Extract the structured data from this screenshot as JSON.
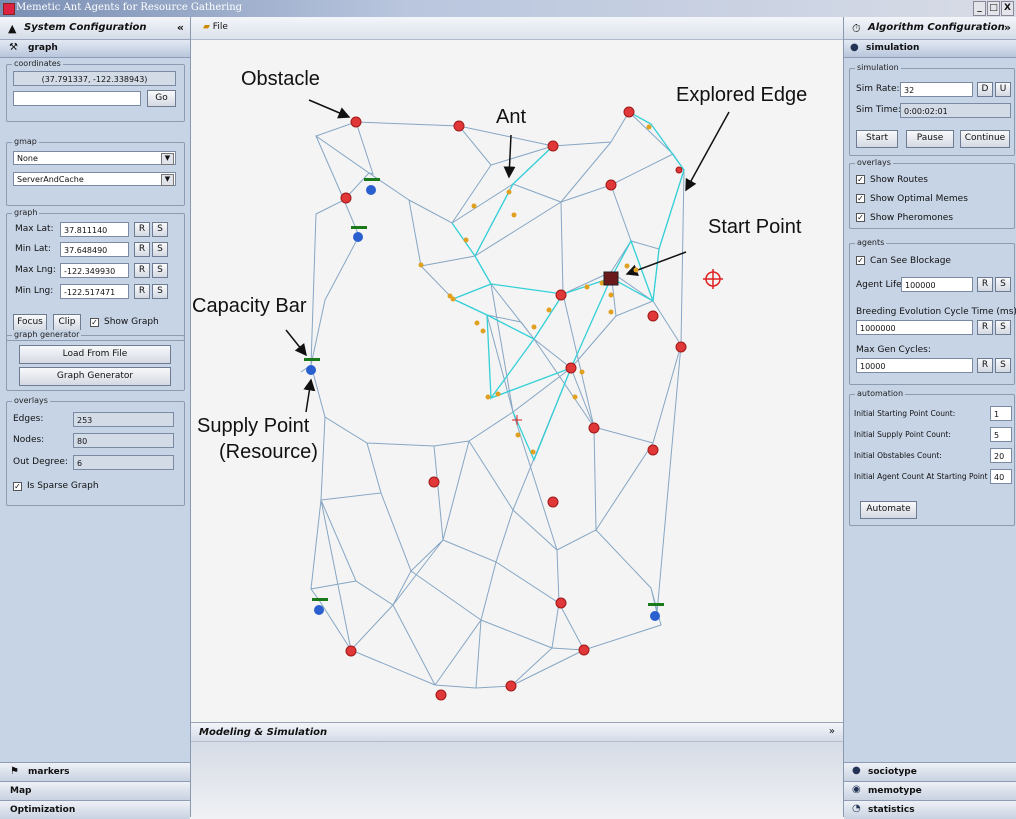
{
  "window": {
    "title": "Memetic Ant Agents for Resource Gathering",
    "controls": [
      "_",
      "□",
      "X"
    ]
  },
  "left_panel": {
    "title": "System Configuration",
    "collapse": "«",
    "tab": "graph",
    "coordinates": {
      "label": "coordinates",
      "value": "(37.791337, -122.338943)",
      "input": "",
      "go": "Go"
    },
    "gmap": {
      "label": "gmap",
      "select1": "None",
      "select2": "ServerAndCache"
    },
    "graph": {
      "label": "graph",
      "rows": [
        {
          "label": "Max Lat:",
          "value": "37.811140"
        },
        {
          "label": "Min Lat:",
          "value": "37.648490"
        },
        {
          "label": "Max Lng:",
          "value": "-122.349930"
        },
        {
          "label": "Min Lng:",
          "value": "-122.517471"
        }
      ],
      "r": "R",
      "s": "S",
      "focus": "Focus",
      "clip": "Clip",
      "show_graph": "Show Graph"
    },
    "generator": {
      "label": "graph generator",
      "load": "Load From File",
      "gen": "Graph Generator"
    },
    "overlays": {
      "label": "overlays",
      "edges_label": "Edges:",
      "edges": "253",
      "nodes_label": "Nodes:",
      "nodes": "80",
      "out_label": "Out Degree:",
      "out": "6",
      "sparse": "Is Sparse Graph"
    },
    "bottom_tabs": [
      "markers",
      "Map",
      "Optimization"
    ]
  },
  "center": {
    "menu": "File",
    "modeling": "Modeling & Simulation",
    "modeling_chev": "»"
  },
  "annotations": {
    "obstacle": "Obstacle",
    "ant": "Ant",
    "explored": "Explored Edge",
    "start": "Start Point",
    "capacity": "Capacity Bar",
    "supply1": "Supply Point",
    "supply2": "(Resource)"
  },
  "right_panel": {
    "title": "Algorithm Configuration",
    "collapse": "»",
    "tab": "simulation",
    "simulation": {
      "label": "simulation",
      "rate_label": "Sim Rate:",
      "rate": "32",
      "d": "D",
      "u": "U",
      "time_label": "Sim Time:",
      "time": "0:00:02:01",
      "start": "Start",
      "pause": "Pause",
      "cont": "Continue"
    },
    "overlays": {
      "label": "overlays",
      "routes": "Show Routes",
      "memes": "Show Optimal Memes",
      "pher": "Show Pheromones"
    },
    "agents": {
      "label": "agents",
      "blockage": "Can See Blockage",
      "life_label": "Agent Life:",
      "life": "100000",
      "breed_label": "Breeding Evolution Cycle Time (ms):",
      "breed": "1000000",
      "gen_label": "Max Gen Cycles:",
      "gen": "10000",
      "r": "R",
      "s": "S"
    },
    "automation": {
      "label": "automation",
      "starting_label": "Initial Starting Point Count:",
      "starting": "1",
      "supply_label": "Initial Supply Point Count:",
      "supply": "5",
      "obst_label": "Initial Obstables Count:",
      "obst": "20",
      "agent_label": "Initial Agent Count At Starting Point",
      "agent": "40",
      "automate": "Automate"
    },
    "bottom_tabs": [
      "sociotype",
      "memotype",
      "statistics"
    ]
  },
  "colors": {
    "edge": "#7fa0c0",
    "explored": "#33d0d8",
    "obstacle": "#e03030",
    "ant": "#e0a020",
    "supply": "#2a5fd0",
    "bar": "#1a7a1a",
    "target": "#e02020"
  }
}
